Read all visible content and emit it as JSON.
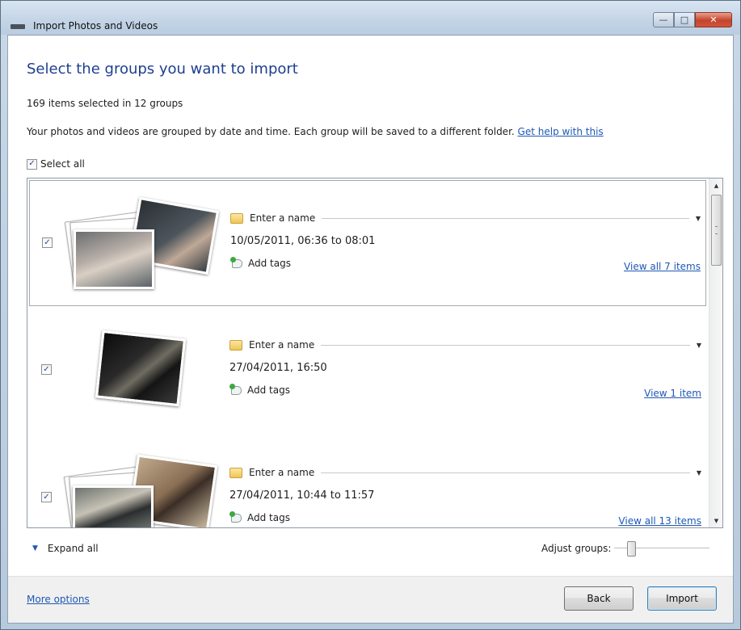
{
  "window": {
    "title": "Import Photos and Videos"
  },
  "heading": "Select the groups you want to import",
  "selection_count": "169 items selected in 12 groups",
  "description": "Your photos and videos are grouped by date and time. Each group will be saved to a different folder.",
  "help_link": "Get help with this",
  "select_all": {
    "label": "Select all",
    "checked": true
  },
  "groups": [
    {
      "name_placeholder": "Enter a name",
      "date": "10/05/2011, 06:36 to 08:01",
      "tags_label": "Add tags",
      "view_label": "View all 7 items",
      "checked": true
    },
    {
      "name_placeholder": "Enter a name",
      "date": "27/04/2011, 16:50",
      "tags_label": "Add tags",
      "view_label": "View 1 item",
      "checked": true
    },
    {
      "name_placeholder": "Enter a name",
      "date": "27/04/2011, 10:44 to 11:57",
      "tags_label": "Add tags",
      "view_label": "View all 13 items",
      "checked": true
    }
  ],
  "expand_all": "Expand all",
  "adjust_groups": {
    "label": "Adjust groups:",
    "value": 0.15
  },
  "footer": {
    "more_options": "More options",
    "back": "Back",
    "import": "Import"
  },
  "icons": {
    "minimize": "minimize-icon",
    "maximize": "maximize-icon",
    "close": "close-icon",
    "folder": "folder-icon",
    "tag": "tag-icon",
    "expand": "chevron-down-icon"
  }
}
